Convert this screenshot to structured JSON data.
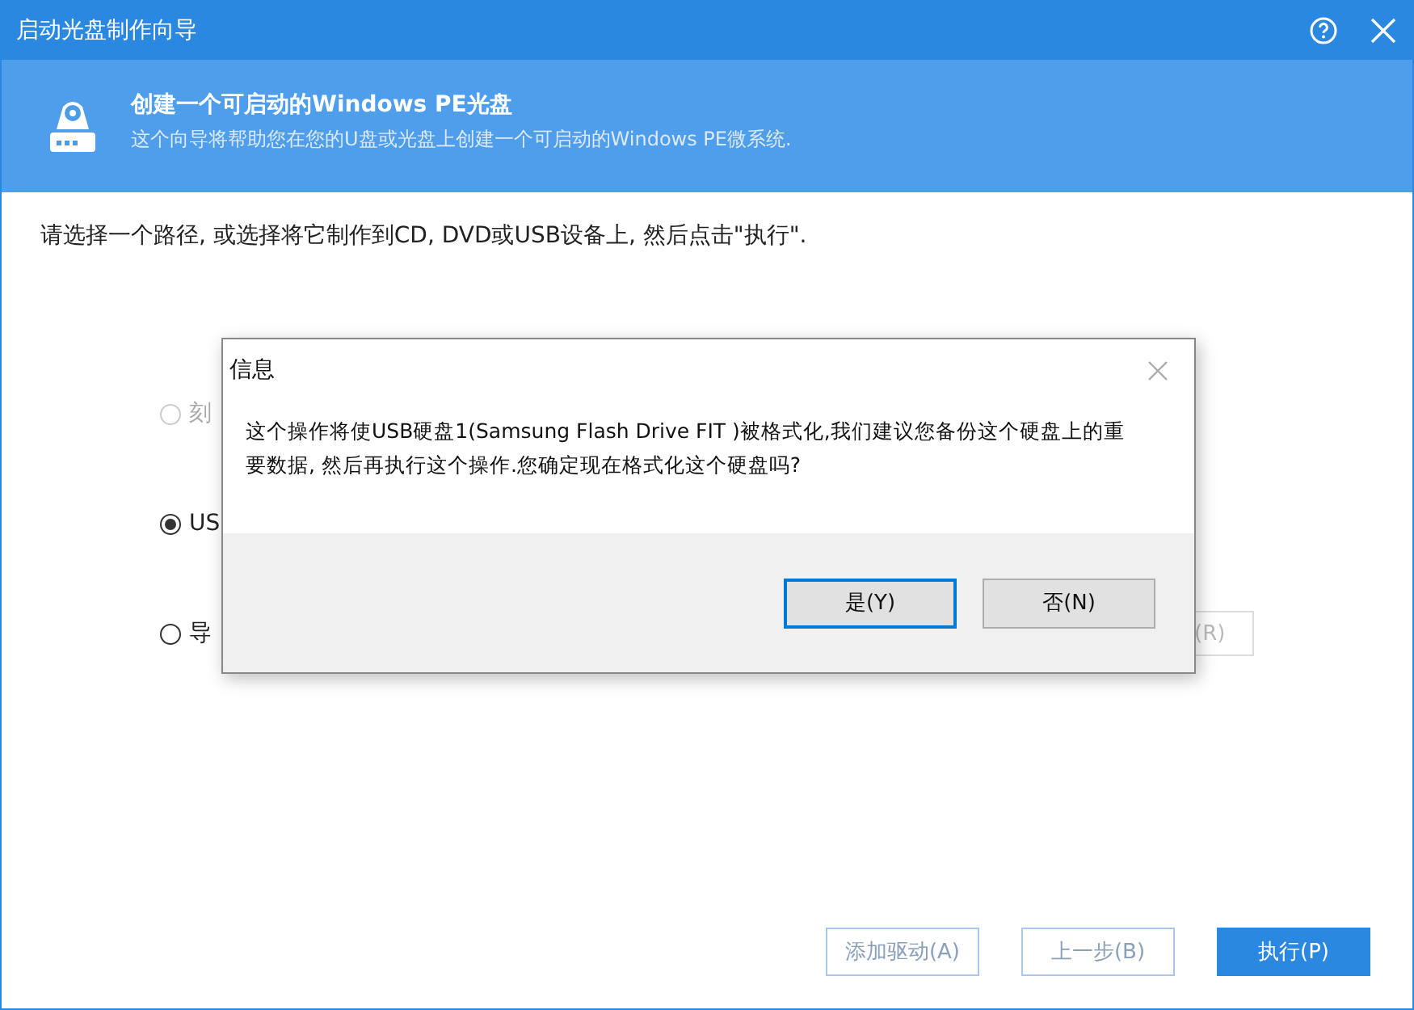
{
  "window": {
    "title": "启动光盘制作向导"
  },
  "header": {
    "title": "创建一个可启动的Windows PE光盘",
    "subtitle": "这个向导将帮助您在您的U盘或光盘上创建一个可启动的Windows PE微系统."
  },
  "instruction": "请选择一个路径, 或选择将它制作到CD, DVD或USB设备上, 然后点击\"执行\".",
  "options": [
    {
      "label": "刻",
      "selected": false,
      "disabled": true
    },
    {
      "label": "US",
      "selected": true,
      "disabled": false
    },
    {
      "label": "导",
      "selected": false,
      "disabled": false
    }
  ],
  "side_button": {
    "label": "(R)",
    "disabled": true
  },
  "buttons": [
    {
      "label": "添加驱动(A)",
      "kind": "outline"
    },
    {
      "label": "上一步(B)",
      "kind": "outline"
    },
    {
      "label": "执行(P)",
      "kind": "primary"
    }
  ],
  "dialog": {
    "title": "信息",
    "message": "这个操作将使USB硬盘1(Samsung Flash Drive FIT )被格式化,我们建议您备份这个硬盘上的重要数据, 然后再执行这个操作.您确定现在格式化这个硬盘吗?",
    "buttons": [
      {
        "label": "是(Y)",
        "selected": true
      },
      {
        "label": "否(N)",
        "selected": false
      }
    ]
  }
}
